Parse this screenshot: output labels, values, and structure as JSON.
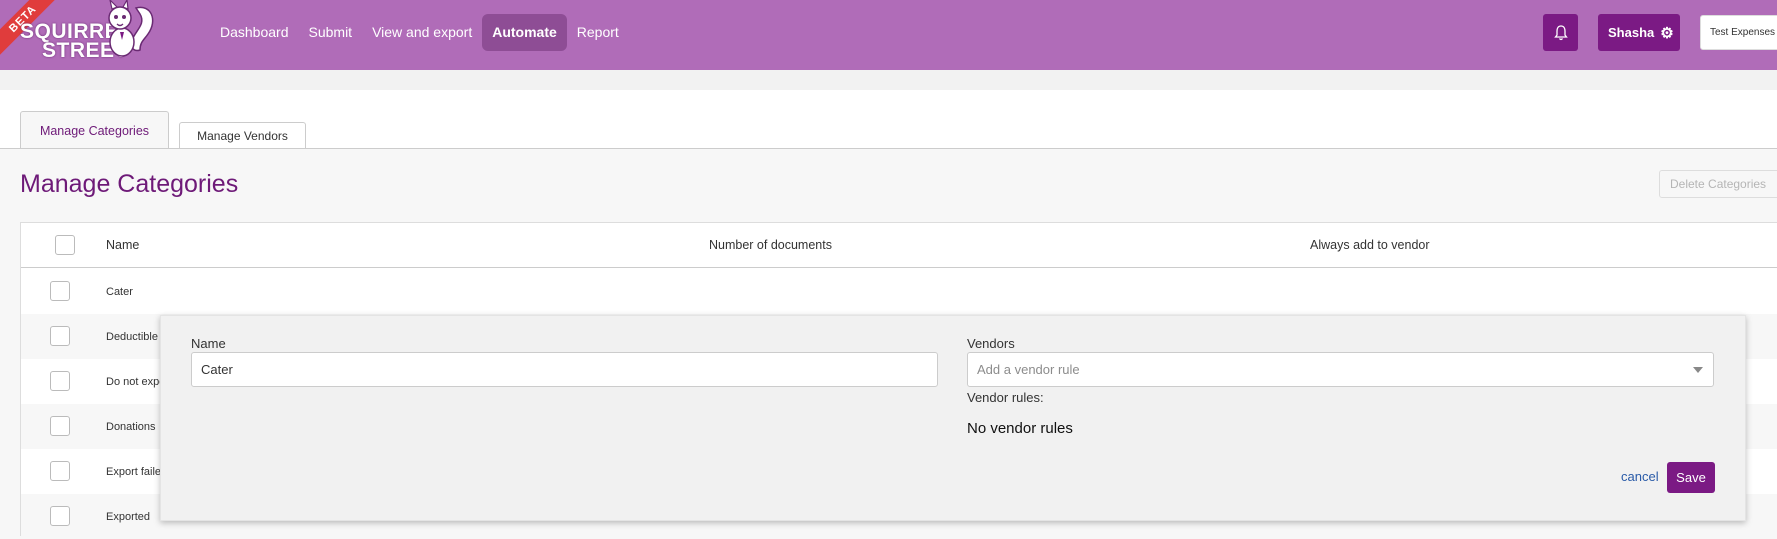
{
  "header": {
    "logo_badge": "BETA",
    "logo_line1": "SQUIRREL",
    "logo_line2": "STREET",
    "nav": [
      {
        "label": "Dashboard",
        "active": false
      },
      {
        "label": "Submit",
        "active": false
      },
      {
        "label": "View and export",
        "active": false
      },
      {
        "label": "Automate",
        "active": true
      },
      {
        "label": "Report",
        "active": false
      }
    ],
    "notifications_icon": "bell-icon",
    "user_name": "Shasha",
    "settings_icon": "gear-icon",
    "company": "Test Expenses",
    "brand_color": "#b06cb8",
    "accent_color": "#7b1a84"
  },
  "tabs": [
    {
      "label": "Manage Categories",
      "active": true
    },
    {
      "label": "Manage Vendors",
      "active": false
    }
  ],
  "page": {
    "title": "Manage Categories",
    "delete_button": "Delete Categories"
  },
  "table": {
    "columns": [
      "Name",
      "Number of documents",
      "Always add to vendor"
    ],
    "rows": [
      {
        "name": "Cater"
      },
      {
        "name": "Deductible"
      },
      {
        "name": "Do not expo"
      },
      {
        "name": "Donations"
      },
      {
        "name": "Export failed"
      },
      {
        "name": "Exported"
      }
    ]
  },
  "edit": {
    "name_label": "Name",
    "name_value": "Cater",
    "vendors_label": "Vendors",
    "vendors_placeholder": "Add a vendor rule",
    "vendor_rules_label": "Vendor rules:",
    "no_rules_text": "No vendor rules",
    "cancel_label": "cancel",
    "save_label": "Save"
  }
}
